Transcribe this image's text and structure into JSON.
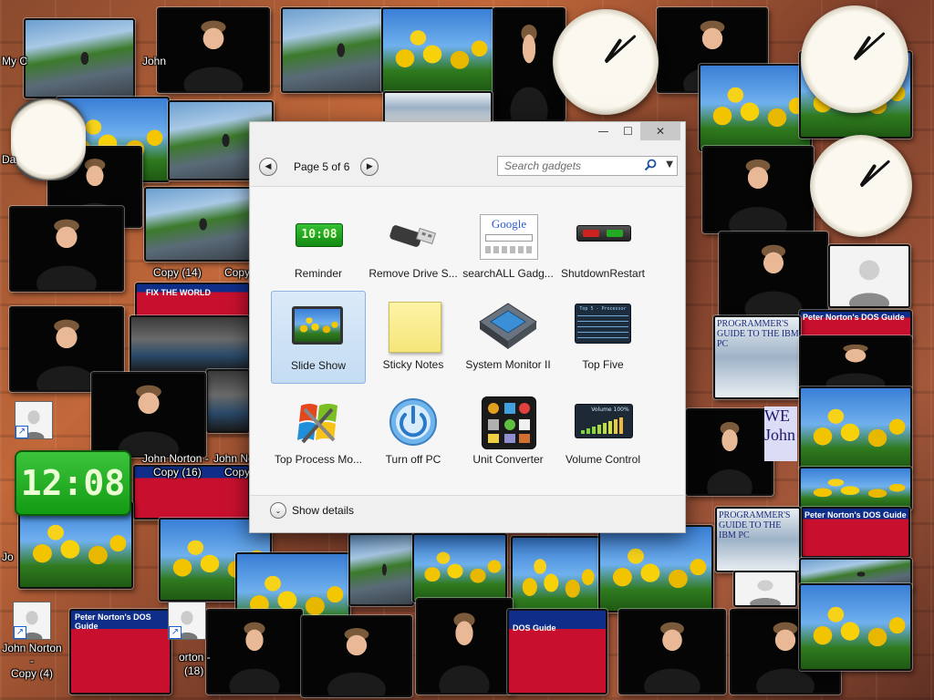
{
  "desktop": {
    "labels": {
      "my_computer": "My C",
      "john_1": "John",
      "da": "Da",
      "copy_14": "Copy (14)",
      "copy_partial": "Copy",
      "copy_16": "Copy (16)",
      "john_norton": "John Norton -",
      "john_norton_icon": "John Norton -",
      "copy_4": "Copy (4)",
      "norton_18_a": "orton -",
      "norton_18_b": "(18)",
      "jo": "Jo"
    },
    "book_texts": {
      "dos_guide_title": "Peter Norton's DOS Guide",
      "dos_guide_sub": "DOS Guide",
      "ibm_title": "PROGRAMMER'S GUIDE TO THE IBM PC",
      "fix_world": "FIX THE WORLD",
      "we_john": "WE John"
    },
    "digital_clock": {
      "time": "12:08"
    },
    "analog_clocks": [
      {
        "name": "clock-top-center",
        "hour": 2,
        "minute": 8
      },
      {
        "name": "clock-top-right",
        "hour": 2,
        "minute": 8
      },
      {
        "name": "clock-mid-right",
        "hour": 2,
        "minute": 8
      }
    ]
  },
  "gallery": {
    "window_buttons": {
      "minimize": "—",
      "maximize": "☐",
      "close": "✕"
    },
    "pager": {
      "prev": "◀",
      "next": "▶",
      "text": "Page 5 of 6"
    },
    "search": {
      "placeholder": "Search gadgets",
      "dropdown": "▼"
    },
    "gadgets": [
      {
        "label": "Reminder",
        "icon": "reminder-icon",
        "display": "10:08"
      },
      {
        "label": "Remove Drive S...",
        "icon": "usb-drive-icon"
      },
      {
        "label": "searchALL Gadg...",
        "icon": "google-search-icon",
        "display": "Google"
      },
      {
        "label": "ShutdownRestart",
        "icon": "shutdown-restart-icon"
      },
      {
        "label": "Slide Show",
        "icon": "slide-show-icon",
        "selected": true
      },
      {
        "label": "Sticky Notes",
        "icon": "sticky-note-icon"
      },
      {
        "label": "System Monitor II",
        "icon": "cpu-chip-icon"
      },
      {
        "label": "Top Five",
        "icon": "top-five-icon",
        "display": "Top 5 - Processor"
      },
      {
        "label": "Top Process Mo...",
        "icon": "windows-tools-icon"
      },
      {
        "label": "Turn off PC",
        "icon": "power-button-icon"
      },
      {
        "label": "Unit Converter",
        "icon": "unit-converter-icon"
      },
      {
        "label": "Volume Control",
        "icon": "volume-control-icon",
        "display": "Volume 100%"
      }
    ],
    "footer": {
      "show_details": "Show details",
      "chevron": "⌄"
    }
  },
  "colors": {
    "gallery_bg": "#f0f0f0",
    "selection": "#c4dcf3",
    "digital_green": "#149b14"
  }
}
